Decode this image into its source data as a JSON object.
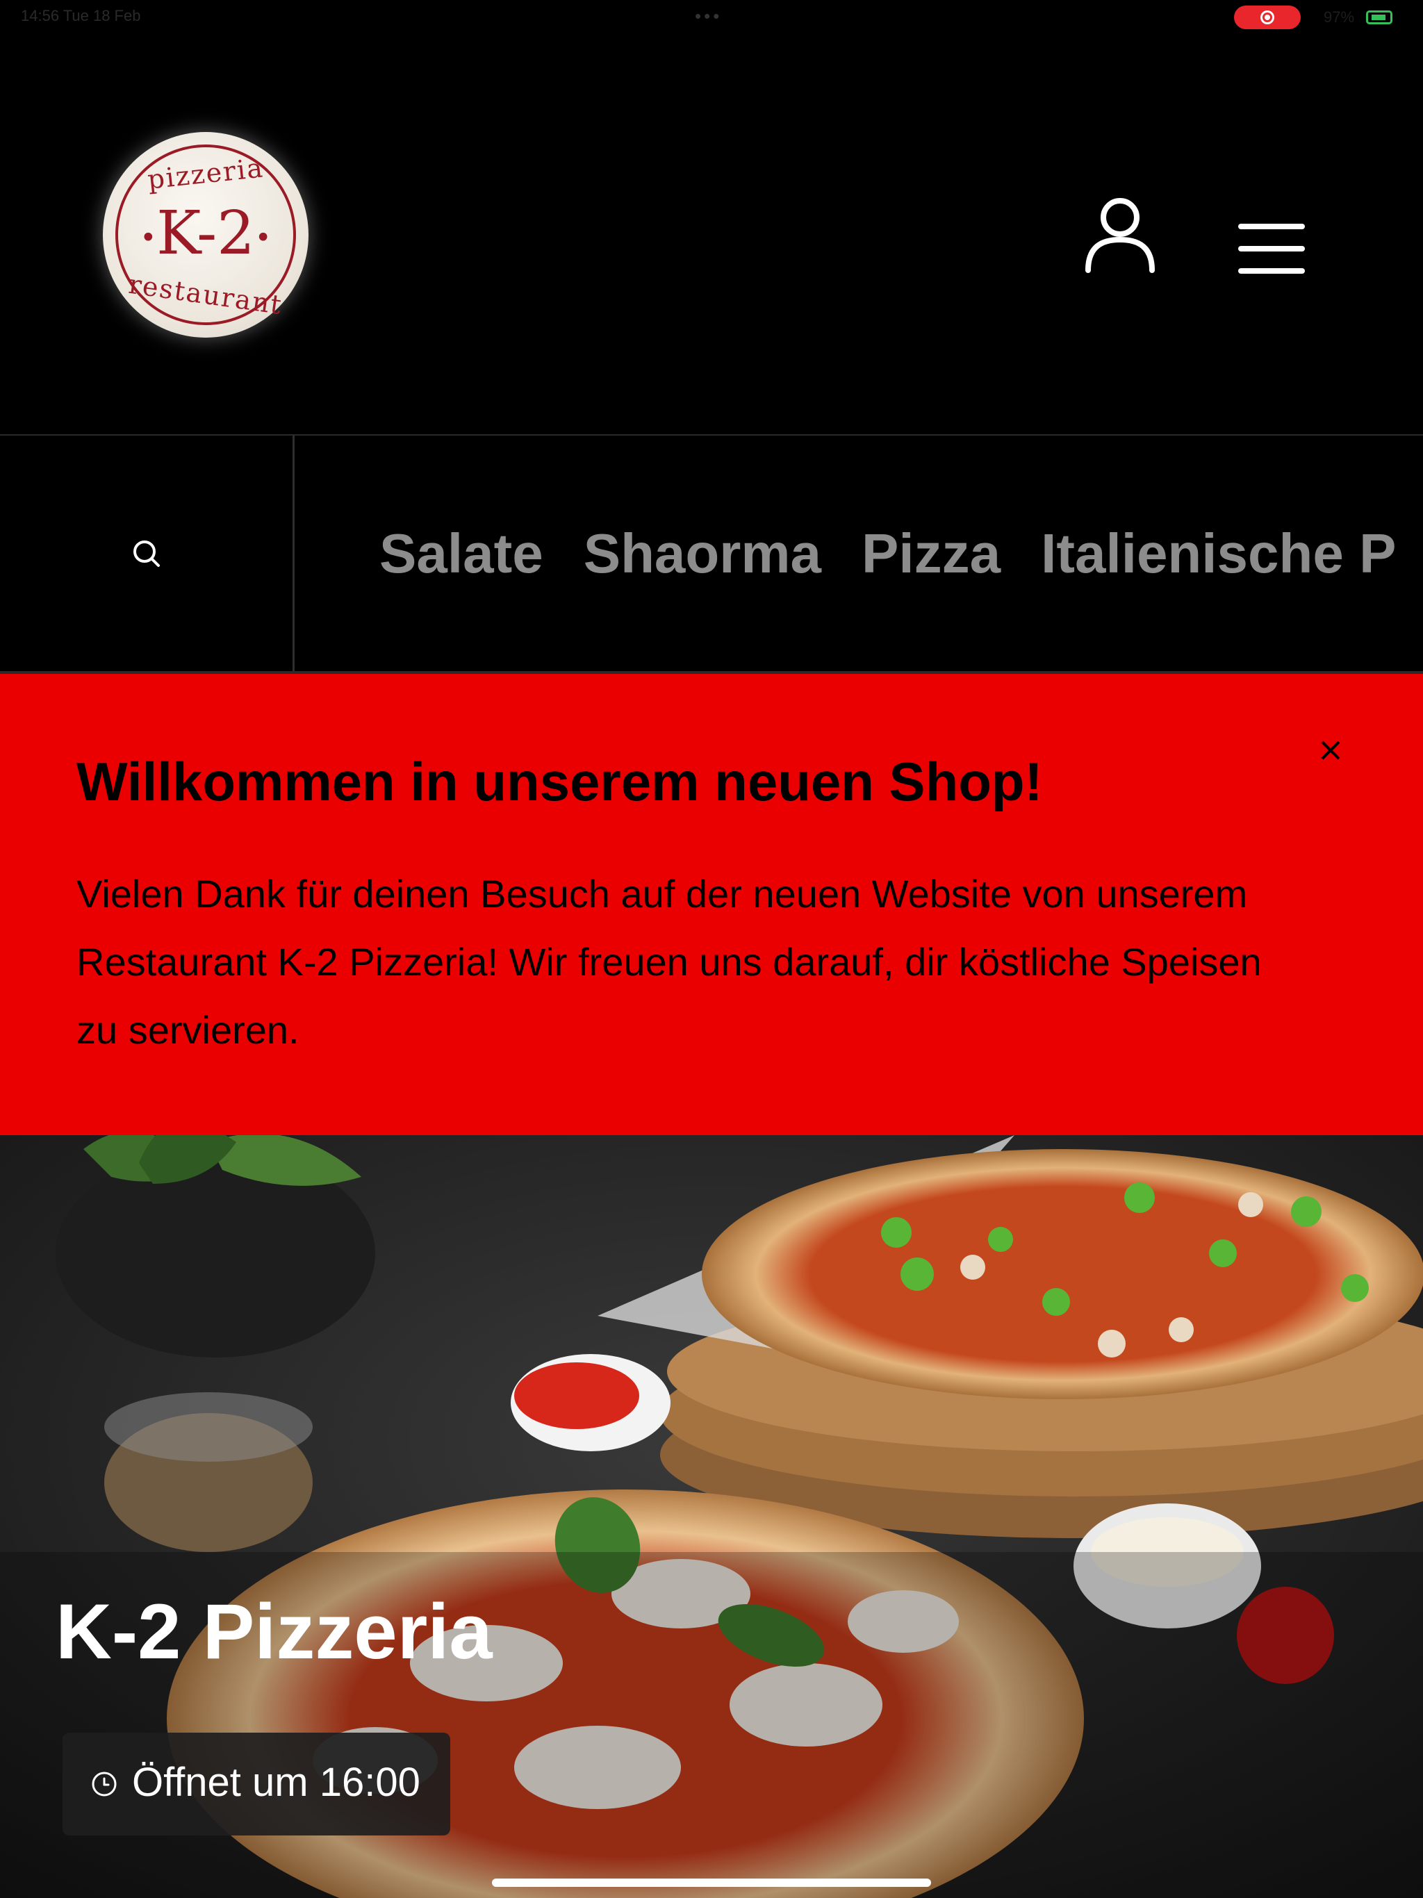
{
  "status_bar": {
    "time_date": "14:56 Tue 18 Feb",
    "dots": "•••",
    "battery": "97%"
  },
  "logo": {
    "top": "pizzeria",
    "main": "K-2",
    "bottom": "restaurant",
    "accent_color": "#9a1b26"
  },
  "header": {
    "account_icon": "user-icon",
    "menu_icon": "hamburger-menu-icon"
  },
  "categories": {
    "search_icon": "search-icon",
    "items": [
      "Salate",
      "Shaorma",
      "Pizza",
      "Italienische P"
    ]
  },
  "welcome": {
    "title": "Willkommen in unserem neuen Shop!",
    "text": "Vielen Dank für deinen Besuch auf der neuen Website von unserem Restaurant K-2 Pizzeria! Wir freuen uns darauf, dir köstliche Speisen zu servieren.",
    "close_icon": "close-icon",
    "background": "#ea0000"
  },
  "hero": {
    "title": "K-2 Pizzeria",
    "hours": "Öffnet um 16:00",
    "clock_icon": "clock-icon"
  }
}
